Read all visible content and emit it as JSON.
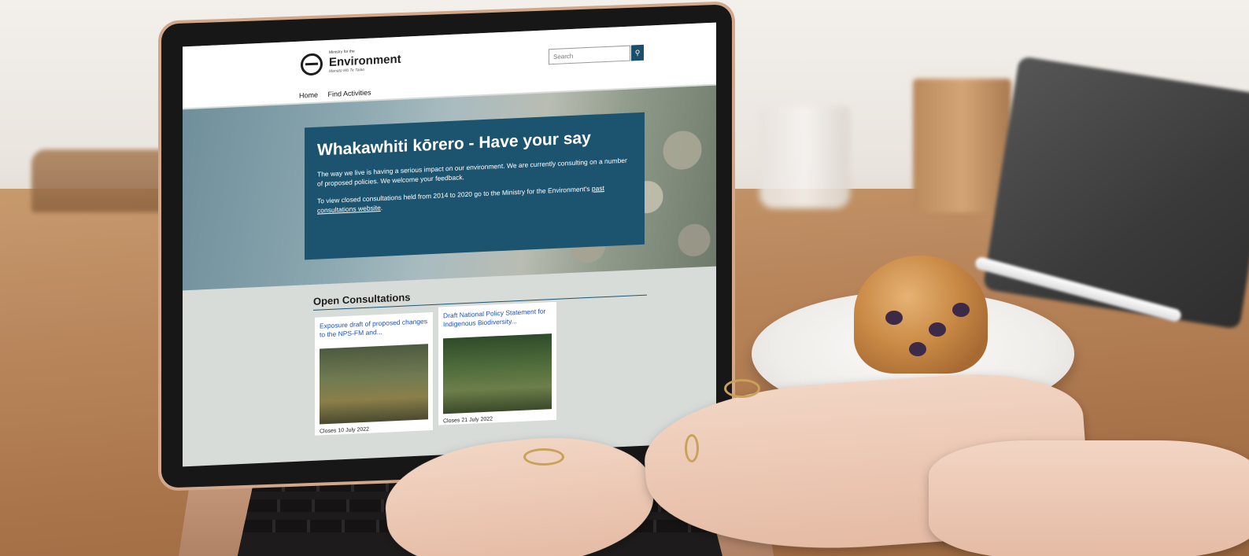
{
  "site": {
    "logo_small": "Ministry for the",
    "logo_name": "Environment",
    "logo_sub": "Manatū Mō Te Taiao",
    "search_placeholder": "Search",
    "search_icon": "search-icon"
  },
  "nav": {
    "items": [
      "Home",
      "Find Activities"
    ]
  },
  "hero": {
    "title": "Whakawhiti kōrero - Have your say",
    "paragraph1": "The way we live is having a serious impact on our environment. We are currently consulting on a number of proposed policies. We welcome your feedback.",
    "paragraph2_prefix": "To view closed consultations held from 2014 to 2020 go to the Ministry for the Environment's ",
    "paragraph2_link": "past consultations website",
    "paragraph2_suffix": "."
  },
  "open_consultations": {
    "heading": "Open Consultations",
    "cards": [
      {
        "title": "Exposure draft of proposed changes to the NPS-FM and...",
        "closes": "Closes 10 July 2022"
      },
      {
        "title": "Draft National Policy Statement for Indigenous Biodiversity...",
        "closes": "Closes 21 July 2022"
      }
    ]
  },
  "colors": {
    "brand_teal": "#1c5470",
    "link_blue": "#1d52c8"
  }
}
